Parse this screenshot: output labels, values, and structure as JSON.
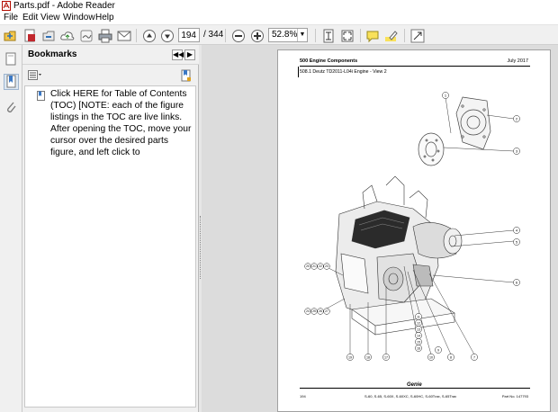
{
  "window": {
    "title": "Parts.pdf - Adobe Reader"
  },
  "menu": [
    "File",
    "Edit",
    "View",
    "Window",
    "Help"
  ],
  "toolbar": {
    "current_page": "194",
    "total_pages": "/ 344",
    "zoom": "52.8%",
    "icons": [
      "open-icon",
      "create-pdf-icon",
      "save-icon",
      "cloud-icon",
      "sign-icon",
      "print-icon",
      "email-icon",
      "previous-page-icon",
      "next-page-icon",
      "zoom-out-icon",
      "zoom-in-icon",
      "fit-page-icon",
      "full-screen-icon",
      "comment-icon",
      "highlight-icon",
      "expand-icon"
    ]
  },
  "bookmarks": {
    "header": "Bookmarks",
    "items": [
      {
        "text": "Click HERE for Table of Contents (TOC) [NOTE: each of the figure listings in the TOC are live links. After opening the TOC, move your cursor over the desired parts figure, and left click to"
      }
    ]
  },
  "page": {
    "section": "500 Engine Components",
    "date": "July 2017",
    "subtitle": "508.1 Deutz TD2011-L04i Engine - View 2",
    "page_number": "194",
    "models": "S-60, S-65, S-60X, S-60XC, S-60HC, S-60Trax, S-65Trax",
    "part_no": "Part No. 147793",
    "logo": "Genie",
    "callouts_right": [
      "1",
      "2",
      "3",
      "4",
      "5",
      "6"
    ],
    "callouts_bottom": [
      "19",
      "18",
      "17",
      "10",
      "9",
      "8",
      "7"
    ],
    "callouts_stack": [
      "11",
      "12",
      "13",
      "14",
      "15",
      "16"
    ],
    "callouts_left_top": [
      "20",
      "21",
      "22",
      "23"
    ],
    "callouts_left_bottom": [
      "24",
      "25",
      "26",
      "27"
    ]
  }
}
